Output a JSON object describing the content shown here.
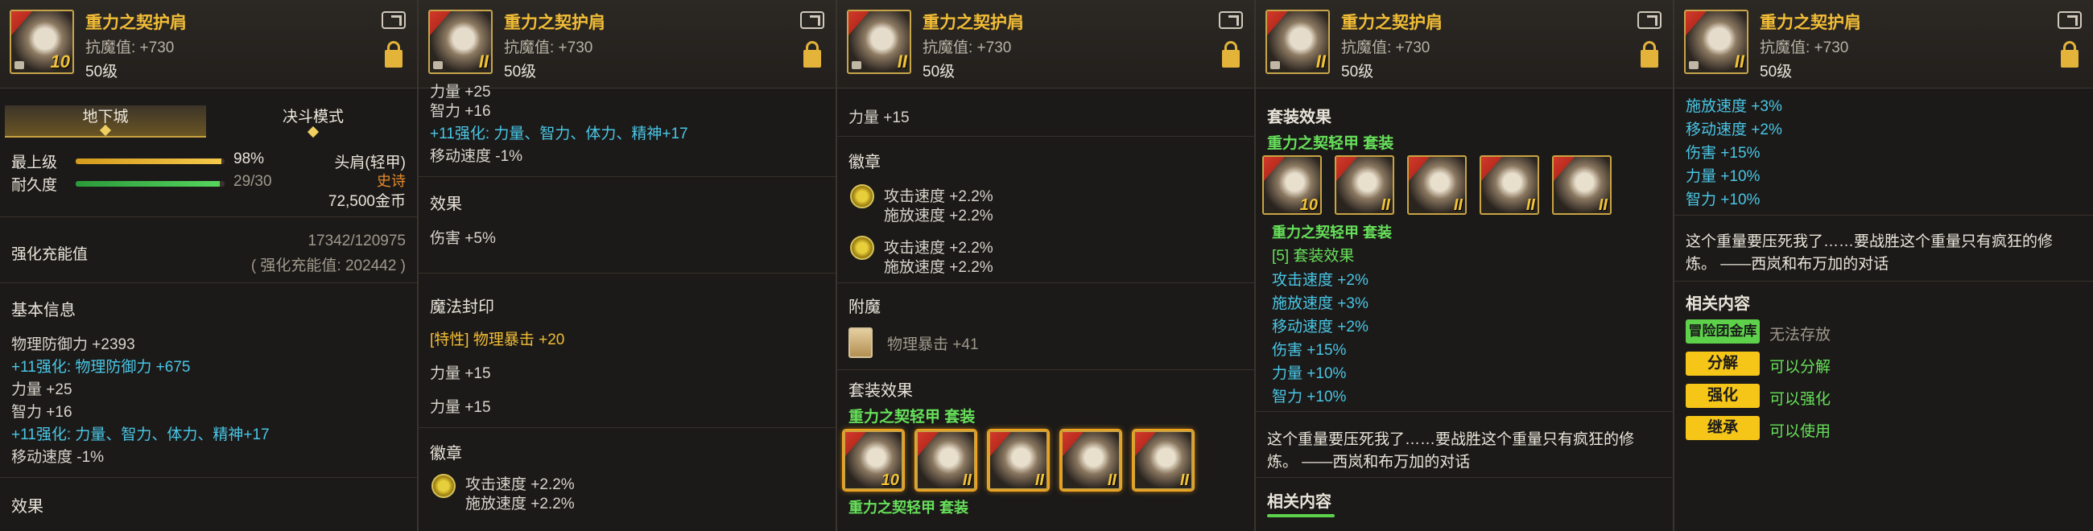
{
  "item": {
    "name": "重力之契护肩",
    "resist": "抗魔值: +730",
    "level": "50级",
    "icon_level": "II",
    "icon_level_first": "10"
  },
  "p1": {
    "tabs": [
      "地下城",
      "决斗模式"
    ],
    "max_label": "最上级",
    "max_value": "98%",
    "max_fraction": 0.98,
    "dur_label": "耐久度",
    "dur_value": "29/30",
    "dur_fraction": 0.967,
    "slot": "头肩(轻甲)",
    "rarity": "史诗",
    "price": "72,500金币",
    "charge_label": "强化充能值",
    "charge_value": "17342/120975",
    "charge_sub": "( 强化充能值: 202442 )",
    "basic_title": "基本信息",
    "lines": [
      "物理防御力 +2393",
      "+11强化: 物理防御力 +675",
      "力量 +25",
      "智力 +16",
      "+11强化: 力量、智力、体力、精神+17",
      "移动速度 -1%"
    ],
    "effect_title": "效果"
  },
  "p2": {
    "cut_line": "力量 +25",
    "lines": [
      "智力 +16",
      "+11强化: 力量、智力、体力、精神+17",
      "移动速度 -1%"
    ],
    "effect_title": "效果",
    "effect_line": "伤害 +5%",
    "seal_title": "魔法封印",
    "seal_lines": [
      "[特性] 物理暴击 +20",
      "力量 +15",
      "力量 +15"
    ],
    "emblem_title": "徽章",
    "emblem_lines": [
      "攻击速度 +2.2%",
      "施放速度 +2.2%"
    ]
  },
  "p3": {
    "top_line": "力量 +15",
    "emblem_title": "徽章",
    "emblem1": [
      "攻击速度 +2.2%",
      "施放速度 +2.2%"
    ],
    "emblem2": [
      "攻击速度 +2.2%",
      "施放速度 +2.2%"
    ],
    "enchant_title": "附魔",
    "enchant_line": "物理暴击 +41",
    "set_title": "套装效果",
    "set_name": "重力之契轻甲 套装",
    "set_caption": "重力之契轻甲 套装"
  },
  "p4": {
    "set_title": "套装效果",
    "set_name": "重力之契轻甲 套装",
    "set_caption": "重力之契轻甲 套装",
    "set_bonus_title": "[5] 套装效果",
    "bonus_lines": [
      "攻击速度 +2%",
      "施放速度 +3%",
      "移动速度 +2%",
      "伤害 +15%",
      "力量 +10%",
      "智力 +10%"
    ],
    "flavor1": "这个重量要压死我了……要战胜这个重量只有疯狂的修",
    "flavor2": "炼。 ——西岚和布万加的对话",
    "related_title": "相关内容"
  },
  "p5": {
    "bonus_lines": [
      "施放速度 +3%",
      "移动速度 +2%",
      "伤害 +15%",
      "力量 +10%",
      "智力 +10%"
    ],
    "flavor1": "这个重量要压死我了……要战胜这个重量只有疯狂的修",
    "flavor2": "炼。 ——西岚和布万加的对话",
    "related_title": "相关内容",
    "rows": [
      {
        "button": "冒险团金库",
        "text": "无法存放"
      },
      {
        "button": "分解",
        "text": "可以分解"
      },
      {
        "button": "强化",
        "text": "可以强化"
      },
      {
        "button": "继承",
        "text": "可以使用"
      }
    ]
  },
  "colors": {
    "gold": "#f2bd36",
    "cyan": "#49c6e6",
    "green": "#66e05a",
    "button_yellow": "#f5c518"
  }
}
